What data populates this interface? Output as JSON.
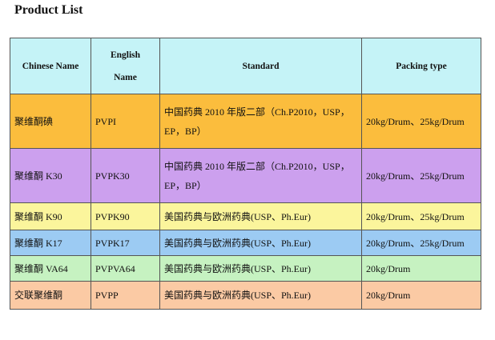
{
  "title": "Product List",
  "columns": {
    "chinese_name": "Chinese Name",
    "english_name_line1": "English",
    "english_name_line2": "Name",
    "standard": "Standard",
    "packing_type": "Packing type"
  },
  "rows": [
    {
      "chinese": "聚维酮碘",
      "english": "PVPI",
      "standard": "中国药典 2010 年版二部（Ch.P2010，USP，EP，BP）",
      "packing": "20kg/Drum、25kg/Drum",
      "color": "#fbbd3d"
    },
    {
      "chinese": "聚维酮 K30",
      "english": "PVPK30",
      "standard": "中国药典 2010 年版二部（Ch.P2010，USP，EP，BP）",
      "packing": "20kg/Drum、25kg/Drum",
      "color": "#cca0ee"
    },
    {
      "chinese": "聚维酮 K90",
      "english": "PVPK90",
      "standard": "美国药典与欧洲药典(USP、Ph.Eur)",
      "packing": "20kg/Drum、25kg/Drum",
      "color": "#fbf59c"
    },
    {
      "chinese": "聚维酮 K17",
      "english": "PVPK17",
      "standard": "美国药典与欧洲药典(USP、Ph.Eur)",
      "packing": "20kg/Drum、25kg/Drum",
      "color": "#9ccbf3"
    },
    {
      "chinese": "聚维酮 VA64",
      "english": "PVPVA64",
      "standard": "美国药典与欧洲药典(USP、Ph.Eur)",
      "packing": "20kg/Drum",
      "color": "#c6f2c1"
    },
    {
      "chinese": "交联聚维酮",
      "english": "PVPP",
      "standard": "美国药典与欧洲药典(USP、Ph.Eur)",
      "packing": "20kg/Drum",
      "color": "#fbcaa4"
    }
  ],
  "header_color": "#c5f3f7"
}
